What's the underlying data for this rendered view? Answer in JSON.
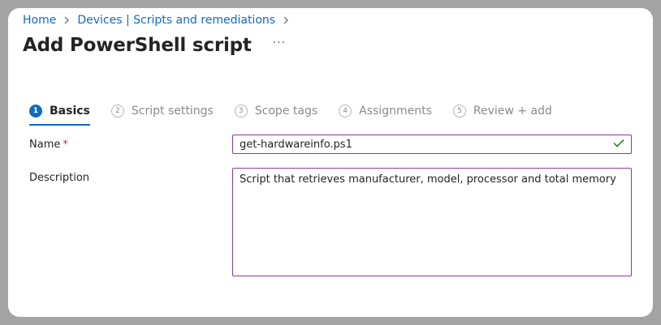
{
  "breadcrumb": {
    "items": [
      "Home",
      "Devices | Scripts and remediations"
    ]
  },
  "header": {
    "title": "Add PowerShell script",
    "more_label": "···"
  },
  "steps": [
    {
      "num": "1",
      "label": "Basics",
      "active": true
    },
    {
      "num": "2",
      "label": "Script settings",
      "active": false
    },
    {
      "num": "3",
      "label": "Scope tags",
      "active": false
    },
    {
      "num": "4",
      "label": "Assignments",
      "active": false
    },
    {
      "num": "5",
      "label": "Review + add",
      "active": false
    }
  ],
  "form": {
    "name_label": "Name",
    "required_marker": "*",
    "name_value": "get-hardwareinfo.ps1",
    "description_label": "Description",
    "description_value": "Script that retrieves manufacturer, model, processor and total memory"
  },
  "colors": {
    "accent": "#0f6cbd",
    "input_border": "#8a3a96",
    "valid_check": "#107c10",
    "required": "#c4314b"
  },
  "icons": {
    "breadcrumb_separator": "chevron-right-icon",
    "valid": "checkmark-icon"
  }
}
